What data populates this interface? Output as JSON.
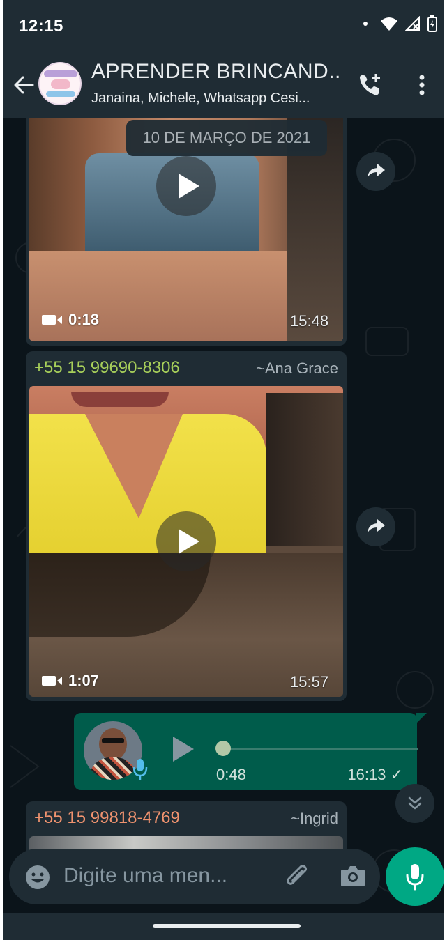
{
  "status_bar": {
    "time": "12:15"
  },
  "header": {
    "title": "APRENDER BRINCAND...",
    "subtitle": "Janaina, Michele, Whatsapp Cesi..."
  },
  "chat": {
    "date_chip": "10 DE MARÇO DE 2021",
    "messages": [
      {
        "type": "video",
        "duration": "0:18",
        "time": "15:48"
      },
      {
        "type": "video",
        "sender_phone": "+55 15 99690-8306",
        "sender_name": "~Ana Grace",
        "duration": "1:07",
        "time": "15:57"
      },
      {
        "type": "audio",
        "outgoing": true,
        "duration": "0:48",
        "time": "16:13 ✓",
        "progress": 0.0
      },
      {
        "type": "partial",
        "sender_phone": "+55 15 99818-4769",
        "sender_name": "~Ingrid"
      }
    ]
  },
  "input": {
    "placeholder": "Digite uma men..."
  },
  "colors": {
    "header_bg": "#1f2c34",
    "chat_bg": "#0b141a",
    "outgoing_bubble": "#005c4b",
    "accent": "#00a884",
    "sender1": "#a8d05a",
    "sender2": "#f0936f"
  }
}
